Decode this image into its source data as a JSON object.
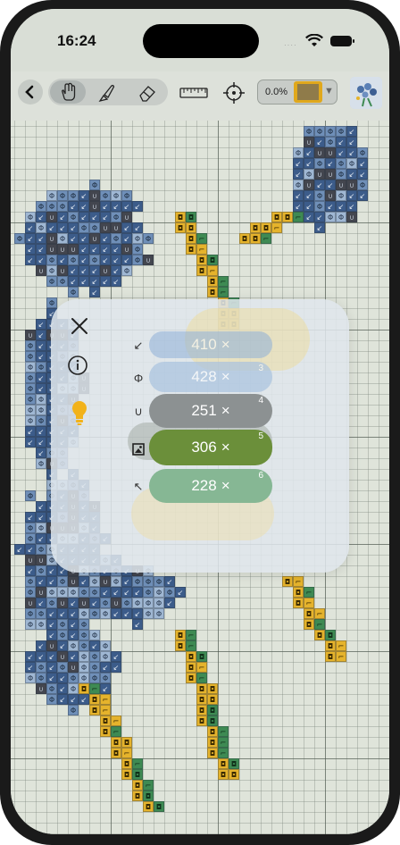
{
  "status_bar": {
    "time": "16:24"
  },
  "toolbar": {
    "back_icon": "chevron-left-icon",
    "tools": [
      "hand-icon",
      "stitch-brush-icon",
      "eraser-icon",
      "ruler-icon",
      "crosshair-icon"
    ],
    "progress_label": "0.0%",
    "current_color": "#8f7b4a",
    "current_color_border": "#e0a81c",
    "dropdown_icon": "triangle-down-icon"
  },
  "legend_panel": {
    "close_icon": "close-icon",
    "info_icon": "info-icon",
    "hint_icon": "lightbulb-icon",
    "items": [
      {
        "symbol_icon": "arrow-down-left-icon",
        "count": "410",
        "multiplier": "×",
        "index": "",
        "color": "#8fb0d8"
      },
      {
        "symbol_icon": "phi-icon",
        "count": "428",
        "multiplier": "×",
        "index": "3",
        "color": "#a9c3e0"
      },
      {
        "symbol_icon": "u-symbol-icon",
        "count": "251",
        "multiplier": "×",
        "index": "4",
        "color": "#8c9192"
      },
      {
        "symbol_icon": "square-symbol-icon",
        "count": "306",
        "multiplier": "×",
        "index": "5",
        "color": "#6b8f3a"
      },
      {
        "symbol_icon": "arrow-up-left-icon",
        "count": "228",
        "multiplier": "×",
        "index": "6",
        "color": "#86b794"
      }
    ]
  },
  "palette": {
    "dark_blue": "#3c5c8a",
    "mid_blue": "#6f8fb8",
    "light_blue": "#9fb7d3",
    "dark_gray": "#43464f",
    "green": "#3e8a53",
    "yellow": "#e5b32c"
  }
}
